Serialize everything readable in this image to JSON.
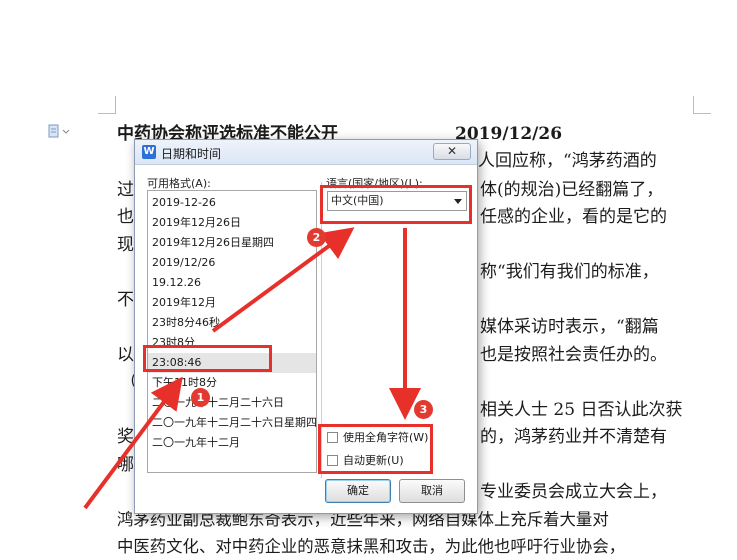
{
  "document": {
    "title": "中药协会称评选标准不能公开",
    "date": "2019/12/26",
    "lines": [
      "人回应称，“鸿茅药酒的",
      "过",
      "体(的规治)已经翻篇了，",
      "也",
      "任感的企业，看的是它的",
      "现",
      "称“我们有我们的标准，",
      "不",
      "媒体采访时表示，“翻篇",
      "以",
      "也是按照社会责任办的。",
      "（",
      "相关人士 25 日否认此次获",
      "奖",
      "的，鸿茅药业并不清楚有",
      "哪",
      "专业委员会成立大会上，",
      "鸿茅药业副总裁鲍东奇表示，近些年来，网络自媒体上充斥着大量对",
      "中医药文化、对中药企业的恶意抹黑和攻击，为此他也呼吁行业协会，"
    ]
  },
  "dialog": {
    "title": "日期和时间",
    "app_icon": "W",
    "close_label": "✕",
    "formats_label": "可用格式(A):",
    "language_label": "语言(国家/地区)(L):",
    "language_value": "中文(中国)",
    "formats": [
      "2019-12-26",
      "2019年12月26日",
      "2019年12月26日星期四",
      "2019/12/26",
      "19.12.26",
      "2019年12月",
      "23时8分46秒",
      "23时8分",
      "23:08:46",
      "下午11时8分",
      "二〇一九年十二月二十六日",
      "二〇一九年十二月二十六日星期四",
      "二〇一九年十二月"
    ],
    "selected_format": "23:08:46",
    "fullwidth_checkbox": "使用全角字符(W)",
    "autoupdate_checkbox": "自动更新(U)",
    "ok_label": "确定",
    "cancel_label": "取消"
  },
  "annotations": {
    "badges": [
      "1",
      "2",
      "3"
    ],
    "color": "#e8302a"
  }
}
